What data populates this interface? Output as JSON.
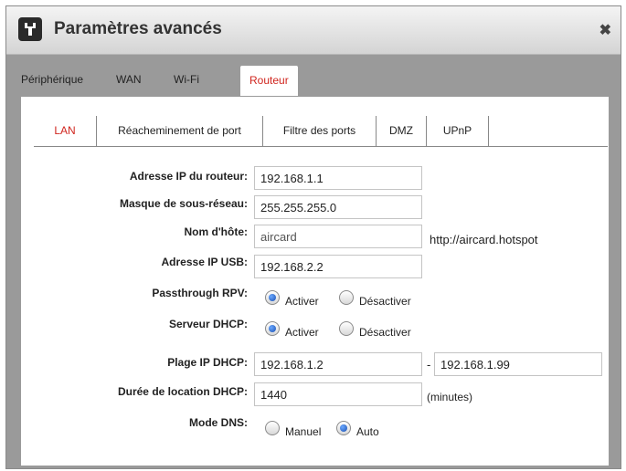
{
  "dialog": {
    "title": "Paramètres avancés",
    "close_icon": "close-icon",
    "title_icon": "tools-icon"
  },
  "main_tabs": [
    "Périphérique",
    "WAN",
    "Wi-Fi",
    "Routeur"
  ],
  "sub_tabs": [
    "LAN",
    "Réacheminement de port",
    "Filtre des ports",
    "DMZ",
    "UPnP"
  ],
  "form": {
    "router_ip": {
      "label": "Adresse IP du routeur:",
      "value": "192.168.1.1"
    },
    "subnet_mask": {
      "label": "Masque de sous-réseau:",
      "value": "255.255.255.0"
    },
    "hostname": {
      "label": "Nom d'hôte:",
      "value": "aircard",
      "url": "http://aircard.hotspot"
    },
    "usb_ip": {
      "label": "Adresse IP USB:",
      "value": "192.168.2.2"
    },
    "vpn_passthrough": {
      "label": "Passthrough RPV:",
      "option_on": "Activer",
      "option_off": "Désactiver",
      "selected": "Activer"
    },
    "dhcp_server": {
      "label": "Serveur DHCP:",
      "option_on": "Activer",
      "option_off": "Désactiver",
      "selected": "Activer"
    },
    "dhcp_range": {
      "label": "Plage IP DHCP:",
      "start": "192.168.1.2",
      "separator": "-",
      "end": "192.168.1.99"
    },
    "dhcp_lease": {
      "label": "Durée de location DHCP:",
      "value": "1440",
      "unit": "(minutes)"
    },
    "dns_mode": {
      "label": "Mode DNS:",
      "option_manual": "Manuel",
      "option_auto": "Auto",
      "selected": "Auto"
    }
  },
  "colors": {
    "accent": "#d0251e",
    "overlay": "#9a9a9a"
  }
}
